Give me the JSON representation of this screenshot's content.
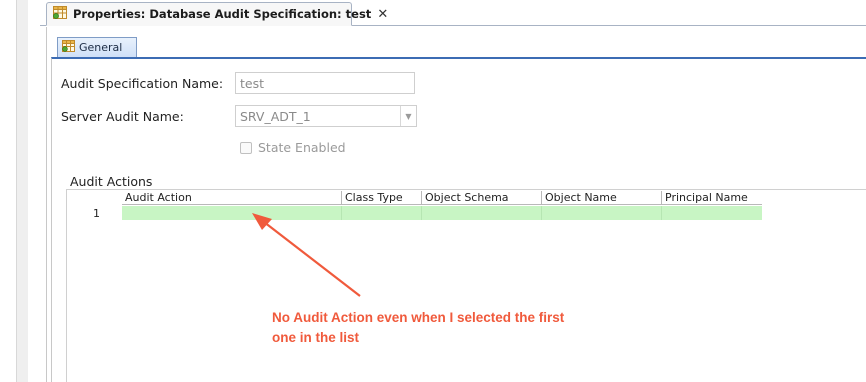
{
  "tab": {
    "title": "Properties: Database Audit Specification: test",
    "close_label": "✕",
    "icon": "table-icon"
  },
  "inner_tab": {
    "label": "General",
    "icon": "table-icon"
  },
  "form": {
    "audit_spec_name_label": "Audit Specification Name:",
    "audit_spec_name_value": "test",
    "server_audit_name_label": "Server Audit Name:",
    "server_audit_name_value": "SRV_ADT_1",
    "state_enabled_label": "State Enabled",
    "state_enabled_checked": false
  },
  "audit_actions": {
    "group_label": "Audit Actions",
    "columns": [
      "Audit Action",
      "Class Type",
      "Object Schema",
      "Object Name",
      "Principal Name"
    ],
    "rows": [
      {
        "row_number": "1",
        "cells": [
          "",
          "",
          "",
          "",
          ""
        ]
      }
    ]
  },
  "annotation": {
    "line1": "No Audit Action even when I selected the first",
    "line2": "one in the list",
    "color": "#f05a3c"
  },
  "colors": {
    "accent_blue": "#3c6cb4",
    "row_highlight": "#c8f5c4"
  }
}
